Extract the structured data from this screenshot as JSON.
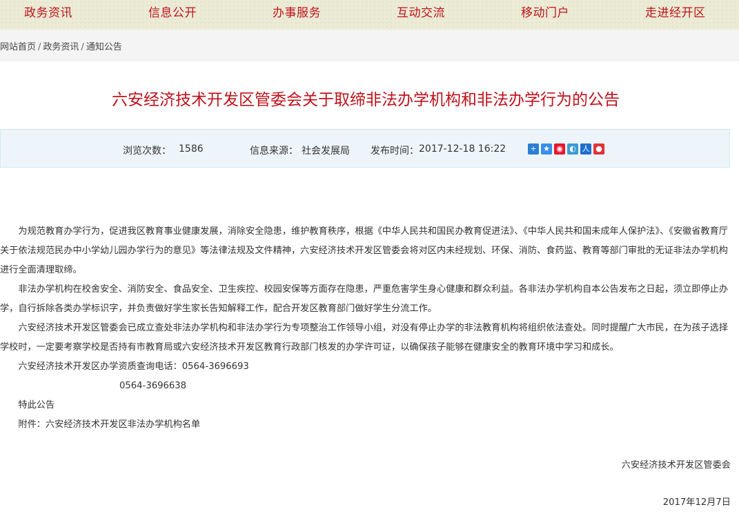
{
  "nav": {
    "items": [
      "政务资讯",
      "信息公开",
      "办事服务",
      "互动交流",
      "移动门户",
      "走进经开区"
    ]
  },
  "breadcrumb": {
    "home": "网站首页",
    "section": "政务资讯",
    "current": "通知公告",
    "separator": "/"
  },
  "article": {
    "title": "六安经济技术开发区管委会关于取缔非法办学机构和非法办学行为的公告",
    "meta": {
      "views_label": "浏览次数：",
      "views": "1586",
      "source_label": "信息来源：",
      "source": "社会发展局",
      "published_label": "发布时间：",
      "published": "2017-12-18 16:22"
    },
    "share_icons": [
      "plus-share-icon",
      "qzone-icon",
      "weibo-icon",
      "tencent-weibo-icon",
      "renren-icon",
      "kaixin-icon"
    ],
    "paragraphs": [
      "为规范教育办学行为，促进我区教育事业健康发展，消除安全隐患，维护教育秩序，根据《中华人民共和国民办教育促进法》、《中华人民共和国未成年人保护法》、《安徽省教育厅关于依法规范民办中小学幼儿园办学行为的意见》等法律法规及文件精神，六安经济技术开发区管委会将对区内未经规划、环保、消防、食药监、教育等部门审批的无证非法办学机构进行全面清理取缔。",
      "非法办学机构在校舍安全、消防安全、食品安全、卫生疾控、校园安保等方面存在隐患，严重危害学生身心健康和群众利益。各非法办学机构自本公告发布之日起，须立即停止办学，自行拆除各类办学标识字，并负责做好学生家长告知解释工作，配合开发区教育部门做好学生分流工作。",
      "六安经济技术开发区管委会已成立查处非法办学机构和非法办学行为专项整治工作领导小组，对没有停止办学的非法教育机构将组织依法查处。同时提醒广大市民，在为孩子选择学校时，一定要考察学校是否持有市教育局或六安经济技术开发区教育行政部门核发的办学许可证，以确保孩子能够在健康安全的教育环境中学习和成长。",
      "六安经济技术开发区办学资质查询电话：0564-3696693"
    ],
    "phone2": "0564-3696638",
    "closing": "特此公告",
    "attachment": "附件：六安经济技术开发区非法办学机构名单",
    "signature": "六安经济技术开发区管委会",
    "date": "2017年12月7日"
  }
}
